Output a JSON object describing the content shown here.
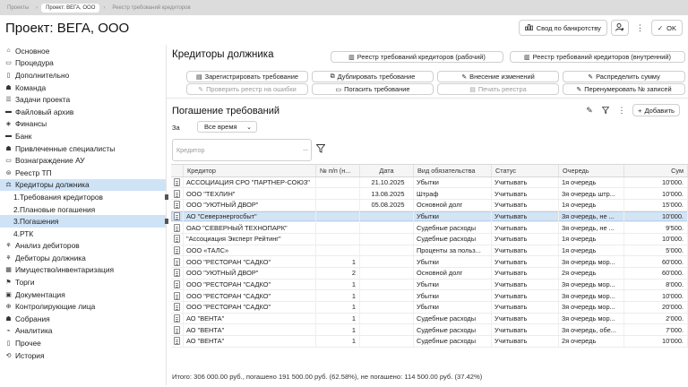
{
  "topbar": {
    "crumbs": [
      "Проекты",
      "Проект: ВЕГА, ООО",
      "Реестр требований кредиторов"
    ]
  },
  "header": {
    "title": "Проект: ВЕГА, ООО",
    "bankruptcy_summary": "Свод по банкротству",
    "ok_label": "OK"
  },
  "sidebar": {
    "items": [
      {
        "label": "Основное",
        "icon": "home-icon"
      },
      {
        "label": "Процедура",
        "icon": "folder-icon"
      },
      {
        "label": "Дополнительно",
        "icon": "document-icon"
      },
      {
        "label": "Команда",
        "icon": "team-icon"
      },
      {
        "label": "Задачи проекта",
        "icon": "tasks-icon"
      },
      {
        "label": "Файловый архив",
        "icon": "folder-icon"
      },
      {
        "label": "Финансы",
        "icon": "finance-icon"
      },
      {
        "label": "Банк",
        "icon": "bank-icon"
      },
      {
        "label": "Привлеченные специалисты",
        "icon": "specialists-icon"
      },
      {
        "label": "Вознаграждение АУ",
        "icon": "reward-icon"
      },
      {
        "label": "Реестр ТП",
        "icon": "registry-icon"
      },
      {
        "label": "Кредиторы должника",
        "icon": "creditors-icon"
      },
      {
        "label": "1.Требования кредиторов",
        "icon": ""
      },
      {
        "label": "2.Плановые погашения",
        "icon": ""
      },
      {
        "label": "3.Погашения",
        "icon": ""
      },
      {
        "label": "4.РТК",
        "icon": ""
      },
      {
        "label": "Анализ дебиторов",
        "icon": "analysis-icon"
      },
      {
        "label": "Дебиторы должника",
        "icon": "debtors-icon"
      },
      {
        "label": "Имущество/инвентаризация",
        "icon": "property-icon"
      },
      {
        "label": "Торги",
        "icon": "auction-icon"
      },
      {
        "label": "Документация",
        "icon": "documents-icon"
      },
      {
        "label": "Контролирующие лица",
        "icon": "controlling-icon"
      },
      {
        "label": "Собрания",
        "icon": "meetings-icon"
      },
      {
        "label": "Аналитика",
        "icon": "analytics-icon"
      },
      {
        "label": "Прочее",
        "icon": "other-icon"
      },
      {
        "label": "История",
        "icon": "history-icon"
      }
    ]
  },
  "panel": {
    "title": "Кредиторы должника",
    "buttons": {
      "reg_working": "Реестр требований кредиторов (рабочий)",
      "reg_internal": "Реестр требований кредиторов (внутренний)",
      "register_claim": "Зарегистрировать требование",
      "duplicate_claim": "Дублировать требование",
      "make_changes": "Внесение изменений",
      "distribute_amount": "Распределить сумму",
      "check_registry": "Проверить реестр на ошибки",
      "repay_claim": "Погасить требование",
      "print_registry": "Печать реестра",
      "renumber": "Перенумеровать № записей"
    }
  },
  "section": {
    "title": "Погашение требований",
    "add_label": "Добавить",
    "period_label": "За",
    "period_value": "Все время",
    "creditor_placeholder": "Кредитор",
    "more": "..."
  },
  "table": {
    "columns": [
      "Кредитор",
      "№ п/п (н...",
      "Дата",
      "Вид обязательства",
      "Статус",
      "Очередь",
      "Сум"
    ],
    "rows": [
      {
        "creditor": "АССОЦИАЦИЯ СРО \"ПАРТНЕР-СОЮЗ\"",
        "num": "",
        "date": "21.10.2025",
        "type": "Убытки",
        "status": "Учитывать",
        "queue": "1я очередь",
        "sum": "10'000."
      },
      {
        "creditor": "ООО \"ТЕХЛИН\"",
        "num": "",
        "date": "13.08.2025",
        "type": "Штраф",
        "status": "Учитывать",
        "queue": "3я очередь штр...",
        "sum": "10'000."
      },
      {
        "creditor": "ООО \"УЮТНЫЙ ДВОР\"",
        "num": "",
        "date": "05.08.2025",
        "type": "Основной долг",
        "status": "Учитывать",
        "queue": "1я очередь",
        "sum": "15'000."
      },
      {
        "creditor": "АО \"Северэнергосбыт\"",
        "num": "",
        "date": "",
        "type": "Убытки",
        "status": "Учитывать",
        "queue": "3я очередь, не ...",
        "sum": "10'000."
      },
      {
        "creditor": "ОАО \"СЕВЕРНЫЙ ТЕХНОПАРК\"",
        "num": "",
        "date": "",
        "type": "Судебные расходы",
        "status": "Учитывать",
        "queue": "3я очередь, не ...",
        "sum": "9'500."
      },
      {
        "creditor": "\"Ассоциация Эксперт Рейтинг\"",
        "num": "",
        "date": "",
        "type": "Судебные расходы",
        "status": "Учитывать",
        "queue": "1я очередь",
        "sum": "10'000."
      },
      {
        "creditor": "ООО «ТАЛС»",
        "num": "",
        "date": "",
        "type": "Проценты за польз...",
        "status": "Учитывать",
        "queue": "1я очередь",
        "sum": "5'000."
      },
      {
        "creditor": "ООО \"РЕСТОРАН \"САДКО\"",
        "num": "1",
        "date": "",
        "type": "Убытки",
        "status": "Учитывать",
        "queue": "3я очередь мор...",
        "sum": "60'000."
      },
      {
        "creditor": "ООО \"УЮТНЫЙ ДВОР\"",
        "num": "2",
        "date": "",
        "type": "Основной долг",
        "status": "Учитывать",
        "queue": "2я очередь",
        "sum": "60'000."
      },
      {
        "creditor": "ООО \"РЕСТОРАН \"САДКО\"",
        "num": "1",
        "date": "",
        "type": "Убытки",
        "status": "Учитывать",
        "queue": "3я очередь мор...",
        "sum": "8'000."
      },
      {
        "creditor": "ООО \"РЕСТОРАН \"САДКО\"",
        "num": "1",
        "date": "",
        "type": "Убытки",
        "status": "Учитывать",
        "queue": "3я очередь мор...",
        "sum": "10'000."
      },
      {
        "creditor": "ООО \"РЕСТОРАН \"САДКО\"",
        "num": "1",
        "date": "",
        "type": "Убытки",
        "status": "Учитывать",
        "queue": "3я очередь мор...",
        "sum": "20'000."
      },
      {
        "creditor": "АО \"ВЕНТА\"",
        "num": "1",
        "date": "",
        "type": "Судебные расходы",
        "status": "Учитывать",
        "queue": "3я очередь мор...",
        "sum": "2'000."
      },
      {
        "creditor": "АО \"ВЕНТА\"",
        "num": "1",
        "date": "",
        "type": "Судебные расходы",
        "status": "Учитывать",
        "queue": "3я очередь, обе...",
        "sum": "7'000."
      },
      {
        "creditor": "АО \"ВЕНТА\"",
        "num": "1",
        "date": "",
        "type": "Судебные расходы",
        "status": "Учитывать",
        "queue": "2я очередь",
        "sum": "10'000."
      }
    ]
  },
  "footer": {
    "totals": "Итого: 306 000.00 руб., погашено 191 500.00 руб. (62.58%), не погашено: 114 500.00 руб. (37.42%)"
  }
}
